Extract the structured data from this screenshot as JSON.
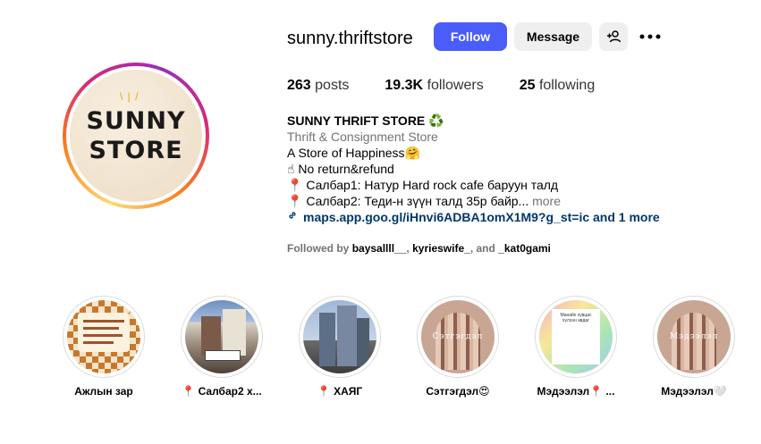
{
  "profile": {
    "username": "sunny.thriftstore",
    "avatar_line1": "SUNNY",
    "avatar_line2": "STORE",
    "follow_label": "Follow",
    "message_label": "Message"
  },
  "stats": {
    "posts_count": "263",
    "posts_label": "posts",
    "followers_count": "19.3K",
    "followers_label": "followers",
    "following_count": "25",
    "following_label": "following"
  },
  "bio": {
    "name": "SUNNY THRIFT STORE",
    "name_emoji": "♻️",
    "category": "Thrift & Consignment Store",
    "line1": "A Store of Happiness",
    "line1_emoji": "🤗",
    "line2_emoji": "☝",
    "line2": "No return&refund",
    "line3_emoji": "📍",
    "line3": "Салбар1: Натур Hard rock cafe баруун талд",
    "line4_emoji": "📍",
    "line4": "Салбар2: Теди-н зүүн талд 35р байр...",
    "more": "more",
    "link": "maps.app.goo.gl/iHnvi6ADBA1omX1M9?g_st=ic and 1 more"
  },
  "followed_by": {
    "prefix": "Followed by",
    "user1": "baysallll__",
    "sep1": ",",
    "user2": "kyrieswife_",
    "sep2": ", and",
    "user3": "_kat0gami"
  },
  "highlights": [
    {
      "label": "Ажлын зар"
    },
    {
      "label": "📍 Салбар2 х..."
    },
    {
      "label": "📍 ХАЯГ"
    },
    {
      "label": "Сэтгэгдэл😍",
      "image_text": "Сэтгэгдэл"
    },
    {
      "label": "Мэдээлэл📍 ...",
      "image_text": "Манайх хувцас хүлээн авдаг"
    },
    {
      "label": "Мэдээлэл🤍",
      "image_text": "Мэдээлэл"
    }
  ],
  "colors": {
    "follow_blue": "#4a5df9",
    "link_blue": "#00376b",
    "secondary_text": "#737373"
  },
  "icons": [
    "add-user-icon",
    "more-options-icon",
    "link-icon"
  ]
}
